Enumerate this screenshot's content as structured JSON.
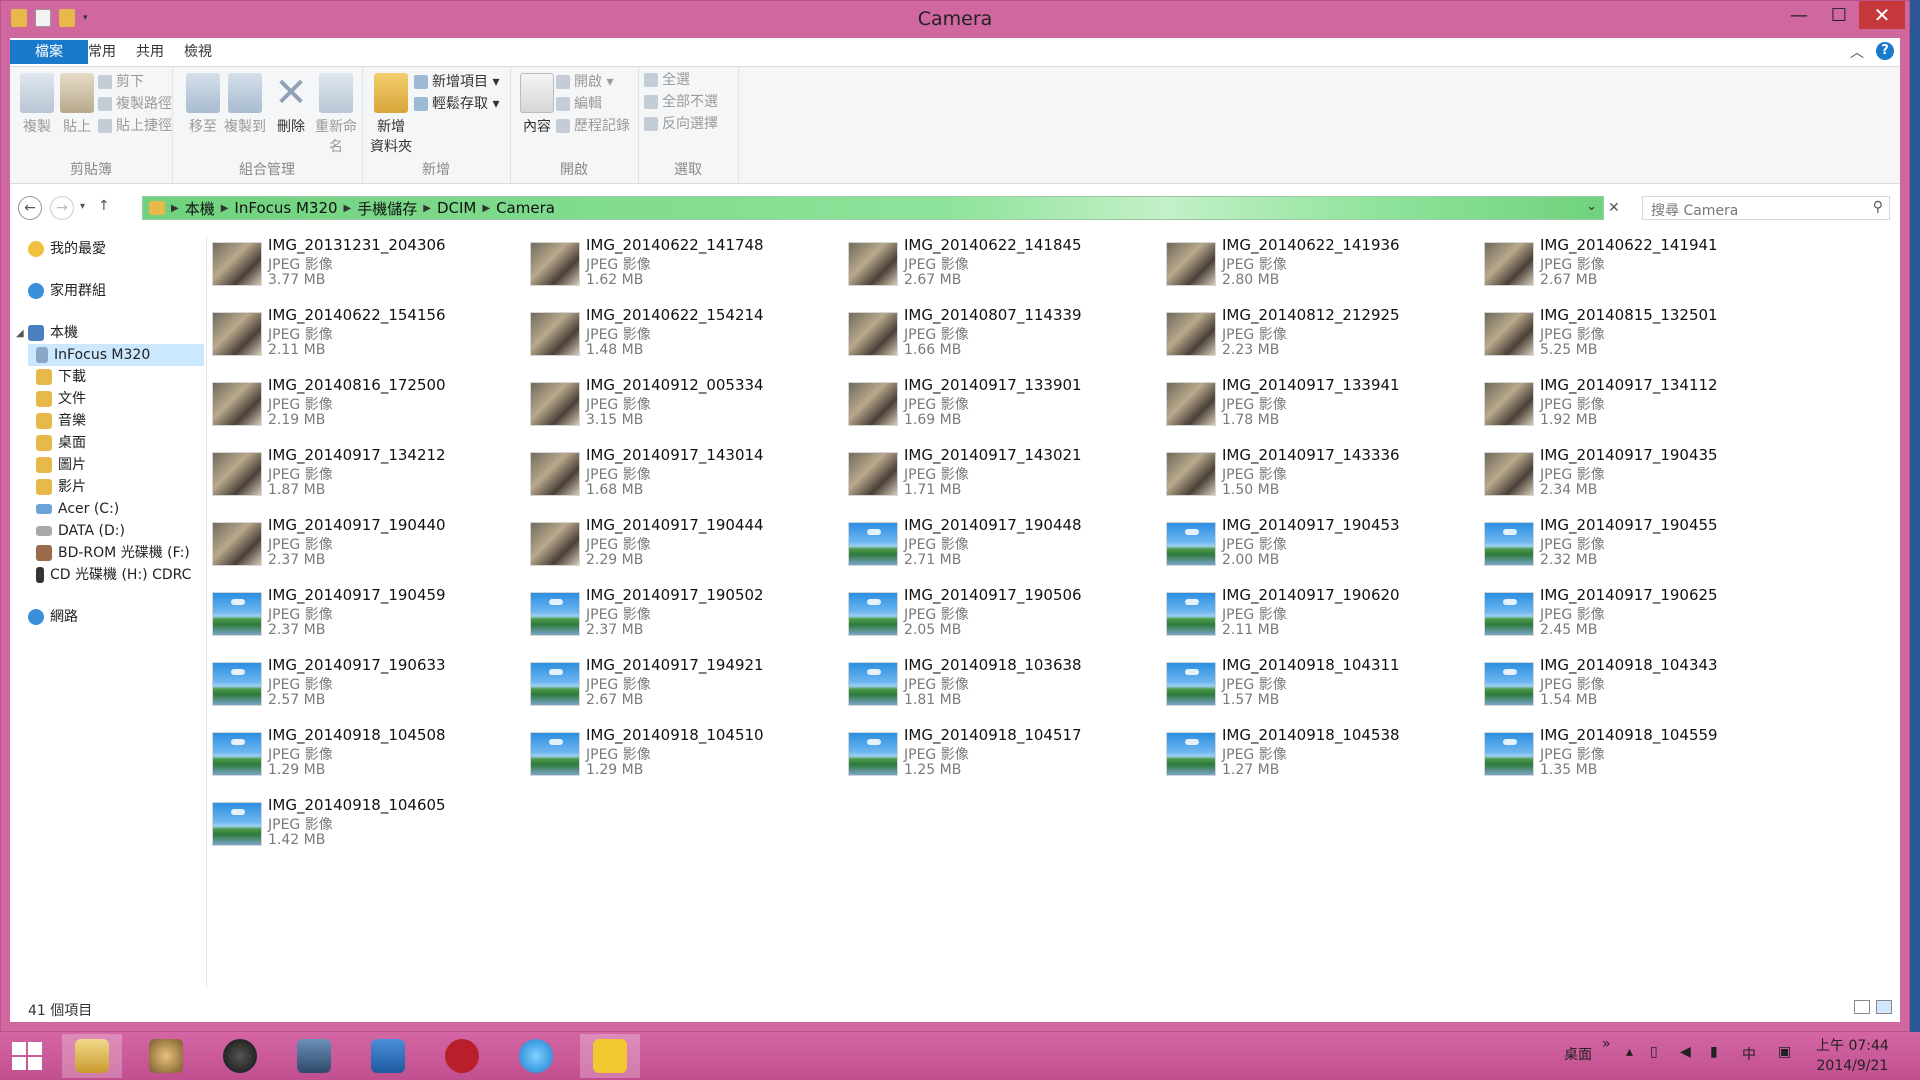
{
  "window": {
    "title": "Camera",
    "min": "—",
    "max": "☐",
    "close": "✕"
  },
  "tabs": [
    "檔案",
    "常用",
    "共用",
    "檢視"
  ],
  "help": "?",
  "ribbon": {
    "clipboard": {
      "label": "剪貼簿",
      "copy": "複製",
      "paste": "貼上",
      "cut": "剪下",
      "copy_path": "複製路徑",
      "paste_shortcut": "貼上捷徑"
    },
    "organize": {
      "label": "組合管理",
      "move_to": "移至",
      "copy_to": "複製到",
      "delete": "刪除",
      "rename": "重新命名"
    },
    "new": {
      "label": "新增",
      "new_folder_1": "新增",
      "new_folder_2": "資料夾",
      "new_item": "新增項目 ▾",
      "easy_access": "輕鬆存取 ▾"
    },
    "open": {
      "label": "開啟",
      "properties": "內容",
      "open": "開啟 ▾",
      "edit": "編輯",
      "history": "歷程記錄"
    },
    "select": {
      "label": "選取",
      "select_all": "全選",
      "select_none": "全部不選",
      "invert": "反向選擇"
    }
  },
  "address": {
    "crumbs": [
      "本機",
      "InFocus M320",
      "手機儲存",
      "DCIM",
      "Camera"
    ],
    "search_placeholder": "搜尋 Camera"
  },
  "sidebar": {
    "favorites": "我的最愛",
    "homegroup": "家用群組",
    "this_pc": "本機",
    "device": "InFocus M320",
    "folders": [
      "下載",
      "文件",
      "音樂",
      "桌面",
      "圖片",
      "影片"
    ],
    "drives": [
      "Acer (C:)",
      "DATA (D:)",
      "BD-ROM 光碟機 (F:)",
      "CD 光碟機 (H:) CDRC"
    ],
    "network": "網路"
  },
  "files": [
    {
      "name": "IMG_20131231_204306",
      "type": "JPEG 影像",
      "size": "3.77 MB",
      "thumb": "photo"
    },
    {
      "name": "IMG_20140622_141748",
      "type": "JPEG 影像",
      "size": "1.62 MB",
      "thumb": "photo"
    },
    {
      "name": "IMG_20140622_141845",
      "type": "JPEG 影像",
      "size": "2.67 MB",
      "thumb": "photo"
    },
    {
      "name": "IMG_20140622_141936",
      "type": "JPEG 影像",
      "size": "2.80 MB",
      "thumb": "photo"
    },
    {
      "name": "IMG_20140622_141941",
      "type": "JPEG 影像",
      "size": "2.67 MB",
      "thumb": "photo"
    },
    {
      "name": "IMG_20140622_154156",
      "type": "JPEG 影像",
      "size": "2.11 MB",
      "thumb": "photo"
    },
    {
      "name": "IMG_20140622_154214",
      "type": "JPEG 影像",
      "size": "1.48 MB",
      "thumb": "photo"
    },
    {
      "name": "IMG_20140807_114339",
      "type": "JPEG 影像",
      "size": "1.66 MB",
      "thumb": "photo"
    },
    {
      "name": "IMG_20140812_212925",
      "type": "JPEG 影像",
      "size": "2.23 MB",
      "thumb": "photo"
    },
    {
      "name": "IMG_20140815_132501",
      "type": "JPEG 影像",
      "size": "5.25 MB",
      "thumb": "photo"
    },
    {
      "name": "IMG_20140816_172500",
      "type": "JPEG 影像",
      "size": "2.19 MB",
      "thumb": "photo"
    },
    {
      "name": "IMG_20140912_005334",
      "type": "JPEG 影像",
      "size": "3.15 MB",
      "thumb": "photo"
    },
    {
      "name": "IMG_20140917_133901",
      "type": "JPEG 影像",
      "size": "1.69 MB",
      "thumb": "photo"
    },
    {
      "name": "IMG_20140917_133941",
      "type": "JPEG 影像",
      "size": "1.78 MB",
      "thumb": "photo"
    },
    {
      "name": "IMG_20140917_134112",
      "type": "JPEG 影像",
      "size": "1.92 MB",
      "thumb": "photo"
    },
    {
      "name": "IMG_20140917_134212",
      "type": "JPEG 影像",
      "size": "1.87 MB",
      "thumb": "photo"
    },
    {
      "name": "IMG_20140917_143014",
      "type": "JPEG 影像",
      "size": "1.68 MB",
      "thumb": "photo"
    },
    {
      "name": "IMG_20140917_143021",
      "type": "JPEG 影像",
      "size": "1.71 MB",
      "thumb": "photo"
    },
    {
      "name": "IMG_20140917_143336",
      "type": "JPEG 影像",
      "size": "1.50 MB",
      "thumb": "photo"
    },
    {
      "name": "IMG_20140917_190435",
      "type": "JPEG 影像",
      "size": "2.34 MB",
      "thumb": "photo"
    },
    {
      "name": "IMG_20140917_190440",
      "type": "JPEG 影像",
      "size": "2.37 MB",
      "thumb": "photo"
    },
    {
      "name": "IMG_20140917_190444",
      "type": "JPEG 影像",
      "size": "2.29 MB",
      "thumb": "photo"
    },
    {
      "name": "IMG_20140917_190448",
      "type": "JPEG 影像",
      "size": "2.71 MB",
      "thumb": "pic"
    },
    {
      "name": "IMG_20140917_190453",
      "type": "JPEG 影像",
      "size": "2.00 MB",
      "thumb": "pic"
    },
    {
      "name": "IMG_20140917_190455",
      "type": "JPEG 影像",
      "size": "2.32 MB",
      "thumb": "pic"
    },
    {
      "name": "IMG_20140917_190459",
      "type": "JPEG 影像",
      "size": "2.37 MB",
      "thumb": "pic"
    },
    {
      "name": "IMG_20140917_190502",
      "type": "JPEG 影像",
      "size": "2.37 MB",
      "thumb": "pic"
    },
    {
      "name": "IMG_20140917_190506",
      "type": "JPEG 影像",
      "size": "2.05 MB",
      "thumb": "pic"
    },
    {
      "name": "IMG_20140917_190620",
      "type": "JPEG 影像",
      "size": "2.11 MB",
      "thumb": "pic"
    },
    {
      "name": "IMG_20140917_190625",
      "type": "JPEG 影像",
      "size": "2.45 MB",
      "thumb": "pic"
    },
    {
      "name": "IMG_20140917_190633",
      "type": "JPEG 影像",
      "size": "2.57 MB",
      "thumb": "pic"
    },
    {
      "name": "IMG_20140917_194921",
      "type": "JPEG 影像",
      "size": "2.67 MB",
      "thumb": "pic"
    },
    {
      "name": "IMG_20140918_103638",
      "type": "JPEG 影像",
      "size": "1.81 MB",
      "thumb": "pic"
    },
    {
      "name": "IMG_20140918_104311",
      "type": "JPEG 影像",
      "size": "1.57 MB",
      "thumb": "pic"
    },
    {
      "name": "IMG_20140918_104343",
      "type": "JPEG 影像",
      "size": "1.54 MB",
      "thumb": "pic"
    },
    {
      "name": "IMG_20140918_104508",
      "type": "JPEG 影像",
      "size": "1.29 MB",
      "thumb": "pic"
    },
    {
      "name": "IMG_20140918_104510",
      "type": "JPEG 影像",
      "size": "1.29 MB",
      "thumb": "pic"
    },
    {
      "name": "IMG_20140918_104517",
      "type": "JPEG 影像",
      "size": "1.25 MB",
      "thumb": "pic"
    },
    {
      "name": "IMG_20140918_104538",
      "type": "JPEG 影像",
      "size": "1.27 MB",
      "thumb": "pic"
    },
    {
      "name": "IMG_20140918_104559",
      "type": "JPEG 影像",
      "size": "1.35 MB",
      "thumb": "pic"
    },
    {
      "name": "IMG_20140918_104605",
      "type": "JPEG 影像",
      "size": "1.42 MB",
      "thumb": "pic"
    }
  ],
  "status": {
    "count": "41 個項目"
  },
  "taskbar": {
    "tray_desktop": "桌面",
    "tray_chevron": "»",
    "tray_ime": "中",
    "time": "上午 07:44",
    "date": "2014/9/21"
  },
  "colors": {
    "accent": "#1979ca",
    "frame": "#d1679f",
    "address_bar": "#6fd27e",
    "close": "#c7383d"
  }
}
